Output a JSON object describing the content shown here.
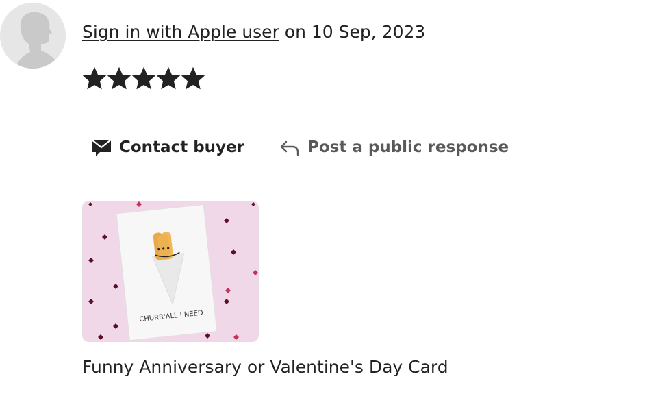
{
  "review": {
    "reviewer_name": "Sign in with Apple user",
    "date_prefix": "on",
    "date": "10 Sep, 2023",
    "rating": 5,
    "rating_max": 5
  },
  "actions": {
    "contact_label": "Contact buyer",
    "respond_label": "Post a public response"
  },
  "listing": {
    "image_card_text": "CHURR'ALL I NEED",
    "title": "Funny Anniversary or Valentine's Day Card"
  },
  "colors": {
    "text": "#222222",
    "muted": "#595959",
    "star": "#222222",
    "thumb_bg": "#f1d8e8"
  },
  "icons": {
    "avatar": "default-user-avatar",
    "star": "star-filled-icon",
    "contact": "envelope-message-icon",
    "respond": "reply-arrow-icon"
  }
}
